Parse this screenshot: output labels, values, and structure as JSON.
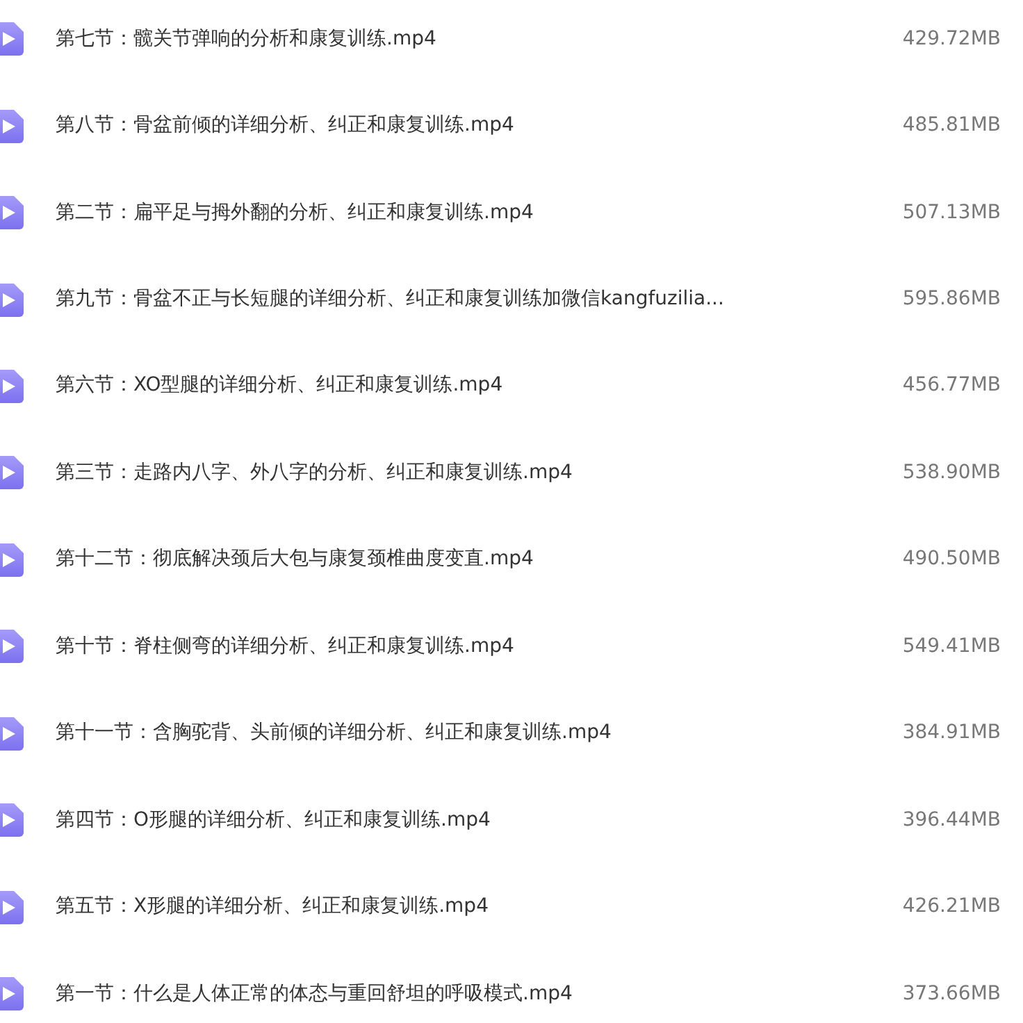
{
  "files": [
    {
      "name": "第七节：髋关节弹响的分析和康复训练.mp4",
      "size": "429.72MB"
    },
    {
      "name": "第八节：骨盆前倾的详细分析、纠正和康复训练.mp4",
      "size": "485.81MB"
    },
    {
      "name": "第二节：扁平足与拇外翻的分析、纠正和康复训练.mp4",
      "size": "507.13MB"
    },
    {
      "name": "第九节：骨盆不正与长短腿的详细分析、纠正和康复训练加微信kangfuzilia...",
      "size": "595.86MB"
    },
    {
      "name": "第六节：XO型腿的详细分析、纠正和康复训练.mp4",
      "size": "456.77MB"
    },
    {
      "name": "第三节：走路内八字、外八字的分析、纠正和康复训练.mp4",
      "size": "538.90MB"
    },
    {
      "name": "第十二节：彻底解决颈后大包与康复颈椎曲度变直.mp4",
      "size": "490.50MB"
    },
    {
      "name": "第十节：脊柱侧弯的详细分析、纠正和康复训练.mp4",
      "size": "549.41MB"
    },
    {
      "name": "第十一节：含胸驼背、头前倾的详细分析、纠正和康复训练.mp4",
      "size": "384.91MB"
    },
    {
      "name": "第四节：O形腿的详细分析、纠正和康复训练.mp4",
      "size": "396.44MB"
    },
    {
      "name": "第五节：X形腿的详细分析、纠正和康复训练.mp4",
      "size": "426.21MB"
    },
    {
      "name": "第一节：什么是人体正常的体态与重回舒坦的呼吸模式.mp4",
      "size": "373.66MB"
    }
  ]
}
